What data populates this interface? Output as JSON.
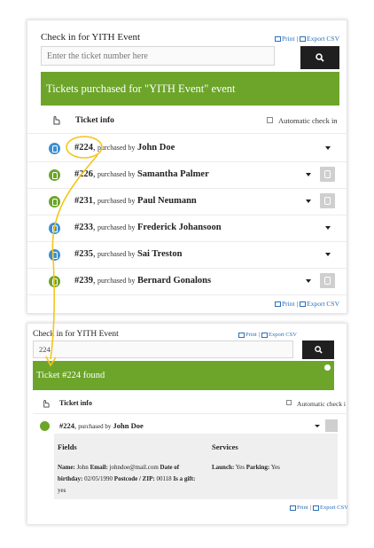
{
  "top": {
    "title": "Check in for YITH Event",
    "print": "Print",
    "separator": "|",
    "export": "Export CSV",
    "search_placeholder": "Enter the ticket number here",
    "banner": "Tickets purchased for \"YITH Event\" event",
    "header_label": "Ticket info",
    "auto_label": "Automatic check in",
    "purchased_by": "purchased by",
    "tickets": [
      {
        "number": "#224",
        "name": "John Doe",
        "status": "blue",
        "button": false
      },
      {
        "number": "#226",
        "name": "Samantha Palmer",
        "status": "green",
        "button": true
      },
      {
        "number": "#231",
        "name": "Paul Neumann",
        "status": "green",
        "button": true
      },
      {
        "number": "#233",
        "name": "Frederick Johansoon",
        "status": "blue",
        "button": false
      },
      {
        "number": "#235",
        "name": "Sai Treston",
        "status": "blue",
        "button": false
      },
      {
        "number": "#239",
        "name": "Bernard Gonalons",
        "status": "green",
        "button": true
      }
    ]
  },
  "bottom": {
    "title": "Check in for YITH Event",
    "print": "Print",
    "separator": "|",
    "export": "Export CSV",
    "search_value": "224",
    "banner": "Ticket #224 found",
    "header_label": "Ticket info",
    "auto_label": "Automatic check i",
    "ticket": {
      "number": "#224",
      "purchased_by": "purchased by",
      "name": "John Doe"
    },
    "fields_header": "Fields",
    "services_header": "Services",
    "fields": {
      "name_label": "Name:",
      "name_value": "John",
      "email_label": "Email:",
      "email_value": "johndoe@mail.com",
      "dob_label": "Date of birthday:",
      "dob_value": "02/05/1990",
      "postcode_label": "Postcode / ZIP:",
      "postcode_value": "00118",
      "gift_label": "Is a gift:",
      "gift_value": "yes"
    },
    "services": {
      "launch_label": "Launch:",
      "launch_value": "Yes",
      "parking_label": "Parking:",
      "parking_value": "Yes"
    }
  },
  "colors": {
    "accent_green": "#6da52a",
    "status_blue": "#3c8fd0",
    "link_blue": "#2a6ebb",
    "arrow_yellow": "#f5c518"
  }
}
